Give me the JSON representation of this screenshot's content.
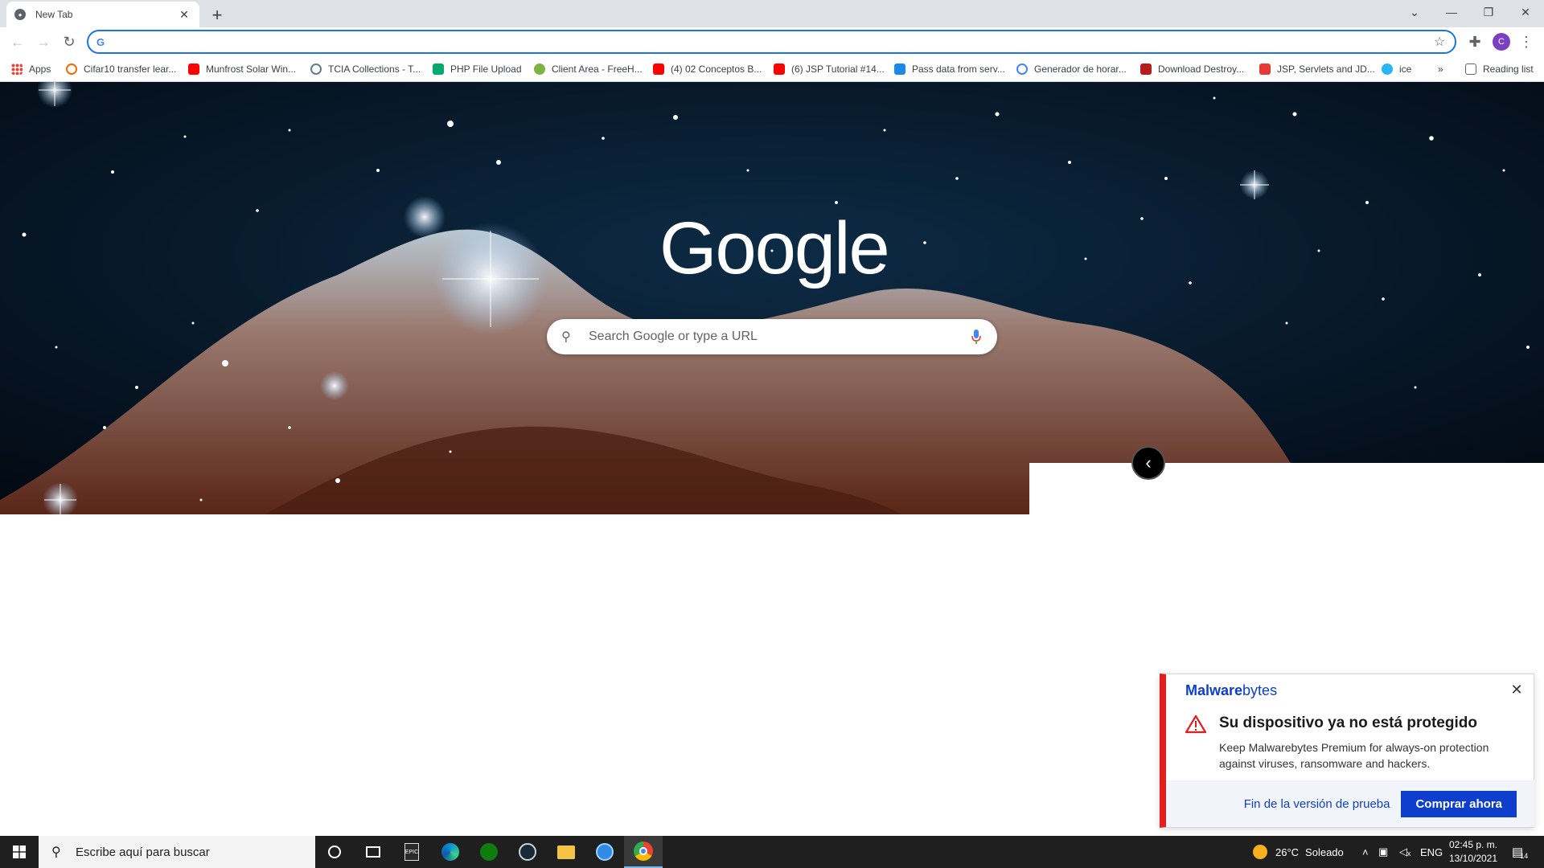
{
  "colors": {
    "accent": "#1a73e8",
    "malwarebytes_blue": "#0d3ecc",
    "alert_red": "#e31e1e",
    "taskbar": "#1f1f1f"
  },
  "tab": {
    "title": "New Tab",
    "close_icon": "close-icon"
  },
  "toolbar": {
    "address_value": "",
    "reading_list": "Reading list",
    "profile_initial": "C"
  },
  "bookmarks": [
    {
      "label": "Apps",
      "icon": "apps-grid-icon"
    },
    {
      "label": "Cifar10 transfer lear...",
      "icon": "tensorflow-icon"
    },
    {
      "label": "Munfrost Solar Win...",
      "icon": "youtube-icon"
    },
    {
      "label": "TCIA Collections - T...",
      "icon": "tcia-icon"
    },
    {
      "label": "PHP File Upload",
      "icon": "w3schools-icon"
    },
    {
      "label": "Client Area - FreeH...",
      "icon": "freehosting-icon"
    },
    {
      "label": "(4) 02 Conceptos B...",
      "icon": "youtube-icon"
    },
    {
      "label": "(6) JSP Tutorial #14...",
      "icon": "youtube-icon"
    },
    {
      "label": "Pass data from serv...",
      "icon": "pg-icon"
    },
    {
      "label": "Generador de horar...",
      "icon": "g-icon"
    },
    {
      "label": "Download Destroy...",
      "icon": "destroy-icon"
    },
    {
      "label": "JSP, Servlets and JD...",
      "icon": "jsp-icon"
    },
    {
      "label": "ice",
      "icon": "ice-icon"
    }
  ],
  "newtab": {
    "logo": "Google",
    "search_placeholder": "Search Google or type a URL"
  },
  "toast": {
    "brand_bold": "Malware",
    "brand_rest": "bytes",
    "headline": "Su dispositivo ya no está protegido",
    "body": "Keep Malwarebytes Premium for always-on protection against viruses, ransomware and hackers.",
    "trial_link": "Fin de la versión de prueba",
    "buy_button": "Comprar ahora"
  },
  "taskbar": {
    "search_placeholder": "Escribe aquí para buscar",
    "weather_temp": "26°C",
    "weather_text": "Soleado",
    "language": "ENG",
    "time": "02:45 p. m.",
    "date": "13/10/2021",
    "notification_count": "14"
  }
}
